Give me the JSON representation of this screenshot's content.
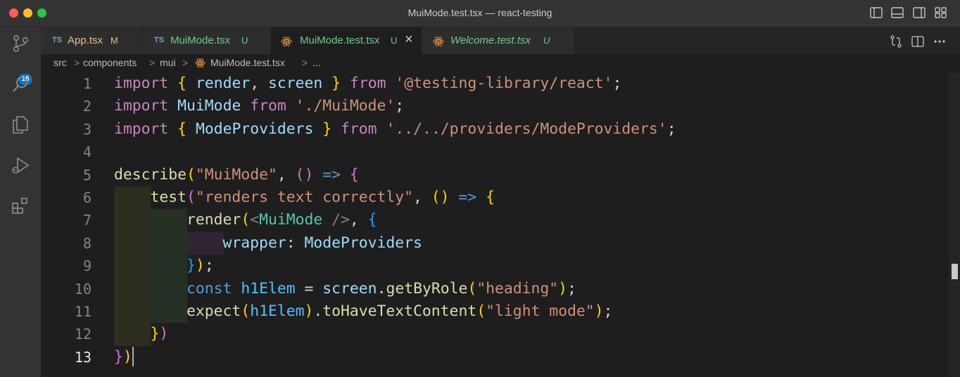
{
  "window": {
    "title": "MuiMode.test.tsx — react-testing"
  },
  "activity": {
    "source_control_badge": "16"
  },
  "tabs": [
    {
      "icon": "TS",
      "label": "App.tsx",
      "status": "M"
    },
    {
      "icon": "TS",
      "label": "MuiMode.tsx",
      "status": "U"
    },
    {
      "icon": "react-icon",
      "label": "MuiMode.test.tsx",
      "status": "U",
      "close": "×"
    },
    {
      "icon": "react-icon",
      "label": "Welcome.test.tsx",
      "status": "U"
    }
  ],
  "breadcrumb": {
    "items": [
      "src",
      "components",
      "mui",
      "MuiMode.test.tsx",
      "..."
    ],
    "separator": ">"
  },
  "editor": {
    "current_line": 13,
    "lines": [
      {
        "number": "1",
        "tokens": [
          [
            "import",
            "#c586c0"
          ],
          [
            " ",
            ""
          ],
          [
            "{",
            "#ffd700"
          ],
          [
            " ",
            ""
          ],
          [
            "render",
            "#9cdcfe"
          ],
          [
            ", ",
            "#d4d4d4"
          ],
          [
            "screen",
            "#9cdcfe"
          ],
          [
            " ",
            ""
          ],
          [
            "}",
            "#ffd700"
          ],
          [
            " ",
            ""
          ],
          [
            "from",
            "#c586c0"
          ],
          [
            " ",
            ""
          ],
          [
            "'@testing-library/react'",
            "#ce9178"
          ],
          [
            ";",
            "#d4d4d4"
          ]
        ]
      },
      {
        "number": "2",
        "tokens": [
          [
            "import",
            "#c586c0"
          ],
          [
            " ",
            ""
          ],
          [
            "MuiMode",
            "#9cdcfe"
          ],
          [
            " ",
            ""
          ],
          [
            "from",
            "#c586c0"
          ],
          [
            " ",
            ""
          ],
          [
            "'./MuiMode'",
            "#ce9178"
          ],
          [
            ";",
            "#d4d4d4"
          ]
        ]
      },
      {
        "number": "3",
        "tokens": [
          [
            "import",
            "#c586c0"
          ],
          [
            " ",
            ""
          ],
          [
            "{",
            "#ffd700"
          ],
          [
            " ",
            ""
          ],
          [
            "ModeProviders",
            "#9cdcfe"
          ],
          [
            " ",
            ""
          ],
          [
            "}",
            "#ffd700"
          ],
          [
            " ",
            ""
          ],
          [
            "from",
            "#c586c0"
          ],
          [
            " ",
            ""
          ],
          [
            "'../../providers/ModeProviders'",
            "#ce9178"
          ],
          [
            ";",
            "#d4d4d4"
          ]
        ]
      },
      {
        "number": "4",
        "tokens": []
      },
      {
        "number": "5",
        "tokens": [
          [
            "describe",
            "#dcdcaa"
          ],
          [
            "(",
            "#ffd700"
          ],
          [
            "\"MuiMode\"",
            "#ce9178"
          ],
          [
            ", ",
            "#d4d4d4"
          ],
          [
            "()",
            "#da70d6"
          ],
          [
            " ",
            ""
          ],
          [
            "=>",
            "#569cd6"
          ],
          [
            " ",
            ""
          ],
          [
            "{",
            "#da70d6"
          ]
        ]
      },
      {
        "number": "6",
        "tokens": [
          [
            "    ",
            ""
          ],
          [
            "test",
            "#dcdcaa"
          ],
          [
            "(",
            "#da70d6"
          ],
          [
            "\"renders text correctly\"",
            "#ce9178"
          ],
          [
            ", ",
            "#d4d4d4"
          ],
          [
            "()",
            "#ffd700"
          ],
          [
            " ",
            ""
          ],
          [
            "=>",
            "#569cd6"
          ],
          [
            " ",
            ""
          ],
          [
            "{",
            "#ffd700"
          ]
        ]
      },
      {
        "number": "7",
        "tokens": [
          [
            "        ",
            ""
          ],
          [
            "render",
            "#dcdcaa"
          ],
          [
            "(",
            "#ffd700"
          ],
          [
            "<",
            "#808080"
          ],
          [
            "MuiMode",
            "#4ec9b0"
          ],
          [
            " ",
            ""
          ],
          [
            "/>",
            "#808080"
          ],
          [
            ", ",
            "#d4d4d4"
          ],
          [
            "{",
            "#179fff"
          ]
        ]
      },
      {
        "number": "8",
        "tokens": [
          [
            "            ",
            ""
          ],
          [
            "wrapper",
            "#9cdcfe"
          ],
          [
            ": ",
            "#d4d4d4"
          ],
          [
            "ModeProviders",
            "#9cdcfe"
          ]
        ]
      },
      {
        "number": "9",
        "tokens": [
          [
            "        ",
            ""
          ],
          [
            "}",
            "#179fff"
          ],
          [
            ")",
            "#ffd700"
          ],
          [
            ";",
            "#d4d4d4"
          ]
        ]
      },
      {
        "number": "10",
        "tokens": [
          [
            "        ",
            ""
          ],
          [
            "const",
            "#569cd6"
          ],
          [
            " ",
            ""
          ],
          [
            "h1Elem",
            "#4fc1ff"
          ],
          [
            " ",
            ""
          ],
          [
            "=",
            "#d4d4d4"
          ],
          [
            " ",
            ""
          ],
          [
            "screen",
            "#9cdcfe"
          ],
          [
            ".",
            "#d4d4d4"
          ],
          [
            "getByRole",
            "#dcdcaa"
          ],
          [
            "(",
            "#ffd700"
          ],
          [
            "\"heading\"",
            "#ce9178"
          ],
          [
            ")",
            "#ffd700"
          ],
          [
            ";",
            "#d4d4d4"
          ]
        ]
      },
      {
        "number": "11",
        "tokens": [
          [
            "        ",
            ""
          ],
          [
            "expect",
            "#dcdcaa"
          ],
          [
            "(",
            "#ffd700"
          ],
          [
            "h1Elem",
            "#4fc1ff"
          ],
          [
            ")",
            "#ffd700"
          ],
          [
            ".",
            "#d4d4d4"
          ],
          [
            "toHaveTextContent",
            "#dcdcaa"
          ],
          [
            "(",
            "#ffd700"
          ],
          [
            "\"light mode\"",
            "#ce9178"
          ],
          [
            ")",
            "#ffd700"
          ],
          [
            ";",
            "#d4d4d4"
          ]
        ]
      },
      {
        "number": "12",
        "tokens": [
          [
            "    ",
            ""
          ],
          [
            "}",
            "#ffd700"
          ],
          [
            ")",
            "#da70d6"
          ]
        ]
      },
      {
        "number": "13",
        "tokens": [
          [
            "}",
            "#da70d6"
          ],
          [
            ")",
            "#ffd700"
          ]
        ]
      }
    ]
  },
  "colors": {
    "status_modified": "#e2c08d",
    "status_untracked": "#73c991",
    "accent": "#0078d4"
  }
}
